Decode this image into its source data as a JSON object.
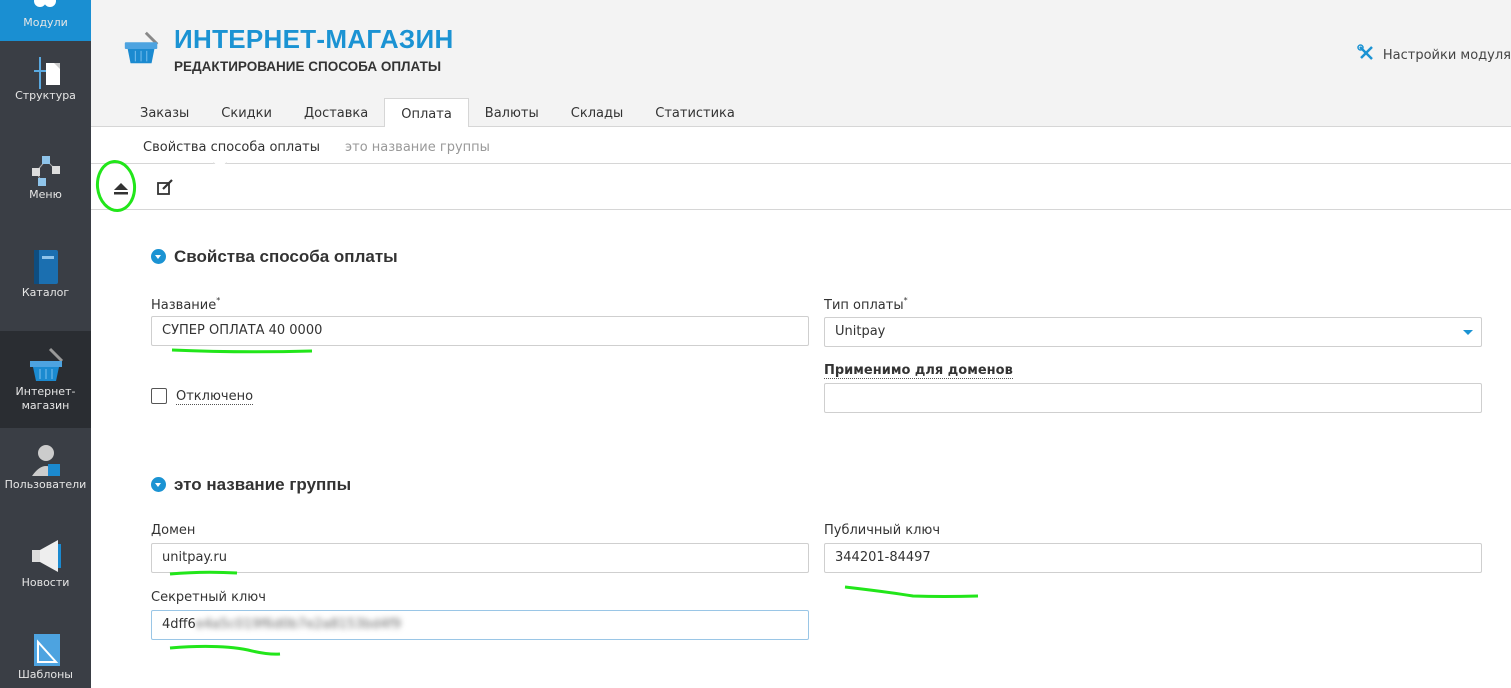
{
  "sidebar": {
    "items": [
      {
        "label": "Модули",
        "icon": "modules-icon"
      },
      {
        "label": "Структура",
        "icon": "structure-icon"
      },
      {
        "label": "Меню",
        "icon": "menu-tree-icon"
      },
      {
        "label": "Каталог",
        "icon": "catalog-book-icon"
      },
      {
        "label": "Интернет-магазин",
        "icon": "shop-basket-icon"
      },
      {
        "label": "Пользователи",
        "icon": "user-icon"
      },
      {
        "label": "Новости",
        "icon": "megaphone-icon"
      },
      {
        "label": "Шаблоны",
        "icon": "template-icon"
      }
    ]
  },
  "header": {
    "title": "ИНТЕРНЕТ-МАГАЗИН",
    "subtitle": "РЕДАКТИРОВАНИЕ СПОСОБА ОПЛАТЫ",
    "settings_label": "Настройки модуля"
  },
  "tabs": [
    "Заказы",
    "Скидки",
    "Доставка",
    "Оплата",
    "Валюты",
    "Склады",
    "Статистика"
  ],
  "active_tab": "Оплата",
  "subtabs": [
    "Свойства способа оплаты",
    "это название группы"
  ],
  "form": {
    "section1": {
      "title": "Свойства способа оплаты",
      "name_label": "Название",
      "name_value": "СУПЕР ОПЛАТА 40 0000",
      "type_label": "Тип оплаты",
      "type_value": "Unitpay",
      "disabled_label": "Отключено",
      "domains_label": "Применимо для доменов",
      "domains_value": ""
    },
    "section2": {
      "title": "это название группы",
      "domain_label": "Домен",
      "domain_value": "unitpay.ru",
      "public_key_label": "Публичный ключ",
      "public_key_value": "344201-84497",
      "secret_key_label": "Секретный ключ",
      "secret_key_visible": "4dff6",
      "secret_key_blurred": "e4a5c019f6d0b7e2a8153bd4f9"
    }
  },
  "colors": {
    "accent": "#1b93d3",
    "sidebar": "#3a3e45",
    "annotation": "#22e61a"
  }
}
